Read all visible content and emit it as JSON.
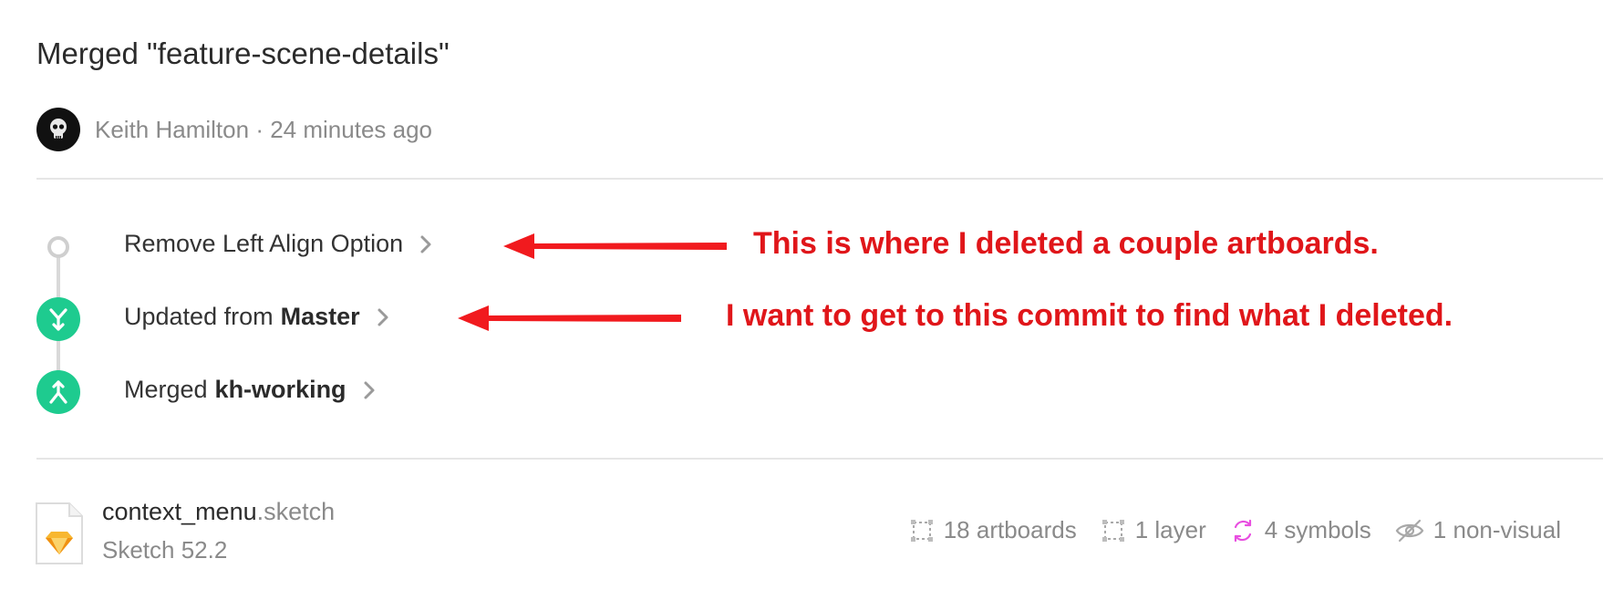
{
  "header": {
    "title": "Merged \"feature-scene-details\"",
    "author": "Keith Hamilton",
    "separator": "·",
    "time": "24 minutes ago"
  },
  "commits": [
    {
      "label": "Remove Left Align Option",
      "bold": "",
      "node": "small-circle-icon"
    },
    {
      "label": "Updated from",
      "bold": "Master",
      "node": "merge-down-icon"
    },
    {
      "label": "Merged",
      "bold": "kh-working",
      "node": "merge-up-icon"
    }
  ],
  "annotations": [
    "This is where I deleted a couple artboards.",
    "I want to get to this commit to find what I deleted."
  ],
  "file": {
    "name": "context_menu",
    "ext": ".sketch",
    "version": "Sketch 52.2"
  },
  "stats": {
    "artboards": "18 artboards",
    "layers": "1 layer",
    "symbols": "4 symbols",
    "nonvisual": "1 non-visual"
  },
  "colors": {
    "accent": "#1ecb8f",
    "annotation": "#e0161a",
    "symbols": "#e84ee0"
  }
}
